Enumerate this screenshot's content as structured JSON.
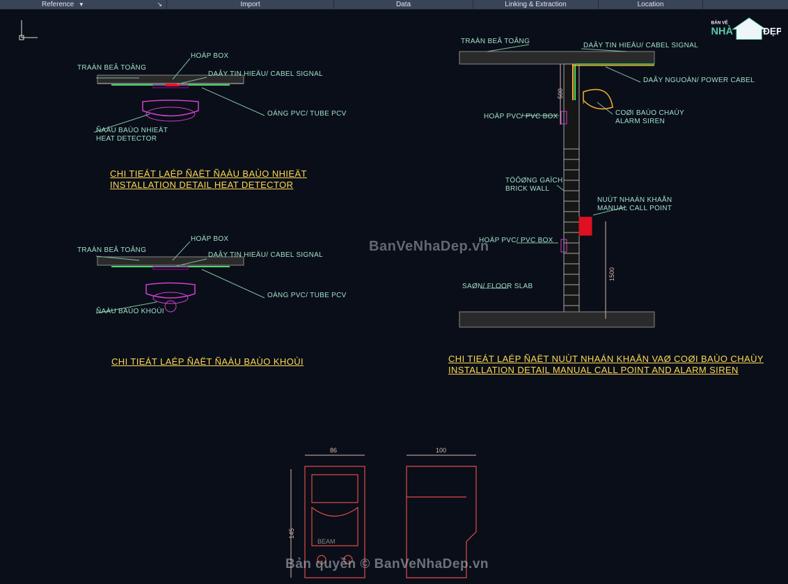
{
  "ribbon": {
    "items": [
      "Reference",
      "Import",
      "Data",
      "Linking & Extraction",
      "Location"
    ]
  },
  "logo": {
    "text_top": "BẢN VẼ",
    "text_mid": "NHÀ",
    "text_right": "ĐẸP"
  },
  "watermarks": {
    "center": "BanVeNhaDep.vn",
    "bottom": "Bản quyền © BanVeNhaDep.vn"
  },
  "detail1": {
    "labels": {
      "ceiling": "TRAÀN BEÂ TOÂNG",
      "box": "HOÄP BOX",
      "signal": "DAÂY TIN HIEÄU/ CABEL SIGNAL",
      "tube": "OÁNG PVC/ TUBE PCV",
      "detector1": "ÑAÀU BAÙO NHIEÄT",
      "detector2": "HEAT DETECTOR"
    },
    "title1": "CHI TIEÁT LAÉP ÑAËT ÑAÀU BAÙO NHIEÄT",
    "title2": "INSTALLATION DETAIL HEAT DETECTOR"
  },
  "detail2": {
    "labels": {
      "ceiling": "TRAÀN BEÂ TOÂNG",
      "box": "HOÄP BOX",
      "signal": "DAÂY TIN HIEÄU/ CABEL SIGNAL",
      "tube": "OÁNG PVC/ TUBE PCV",
      "detector": "ÑAÀU BAÙO KHOÙI"
    },
    "title1": "CHI TIEÁT LAÉP ÑAËT ÑAÀU BAÙO KHOÙI"
  },
  "detail3": {
    "labels": {
      "ceiling": "TRAÀN BEÂ TOÂNG",
      "signal": "DAÂY TIN HIEÄU/ CABEL SIGNAL",
      "power": "DAÂY NGUOÀN/ POWER CABEL",
      "siren1": "COØI BAÙO CHAÙY",
      "siren2": "ALARM SIREN",
      "pvcbox": "HOÄP PVC/ PVC BOX",
      "wall1": "TÖÔØNG GAÏCH",
      "wall2": "BRICK WALL",
      "mcp1": "NUÙT NHAÁN KHAÅN",
      "mcp2": "MANUAL CALL POINT",
      "pvcbox2": "HOÄP PVC/ PVC BOX",
      "floor": "SAØN/ FLOOR SLAB"
    },
    "dims": {
      "top": "500",
      "side": "1500"
    },
    "title1": "CHI TIEÁT LAÉP ÑAËT NUÙT NHAÁN KHAÅN VAØ COØI BAÙO CHAÙY",
    "title2": "INSTALLATION DETAIL MANUAL CALL POINT AND ALARM SIREN"
  },
  "detail4": {
    "dims": {
      "w1": "86",
      "w2": "100",
      "h": "145"
    },
    "label_beam": "BEAM"
  }
}
